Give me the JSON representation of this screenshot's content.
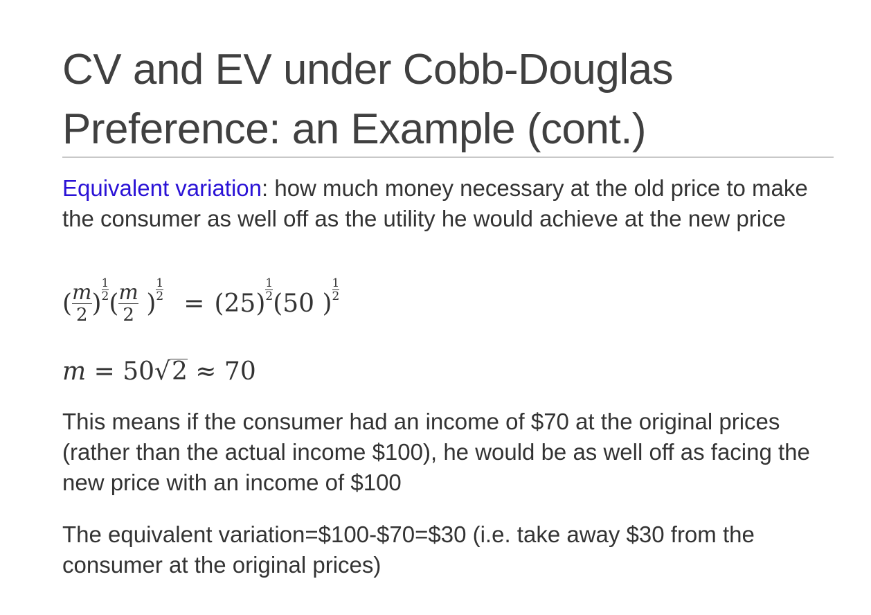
{
  "slide": {
    "title_line1": "CV and EV under Cobb-Douglas",
    "title_line2": "Preference: an Example (cont.)",
    "definition_term": "Equivalent variation",
    "definition_text": ": how much money necessary at the old price to make the consumer as well off as the utility he would achieve at the new price",
    "equation1": {
      "m": "m",
      "two": "2",
      "exp_num": "1",
      "exp_den": "2",
      "equals": "=",
      "v25": "(25)",
      "v50": "(50 )"
    },
    "equation2": {
      "lhs": "m",
      "mid": " = 50",
      "radical": "√",
      "radicand": "2",
      "rhs": " ≈ 70"
    },
    "paragraph2": "This means if the consumer had an income of $70 at the original prices (rather than the actual income $100), he would be as well off as facing the new price with an income of $100",
    "paragraph3": "The equivalent variation=$100-$70=$30 (i.e. take away $30 from the consumer at the original prices)"
  }
}
